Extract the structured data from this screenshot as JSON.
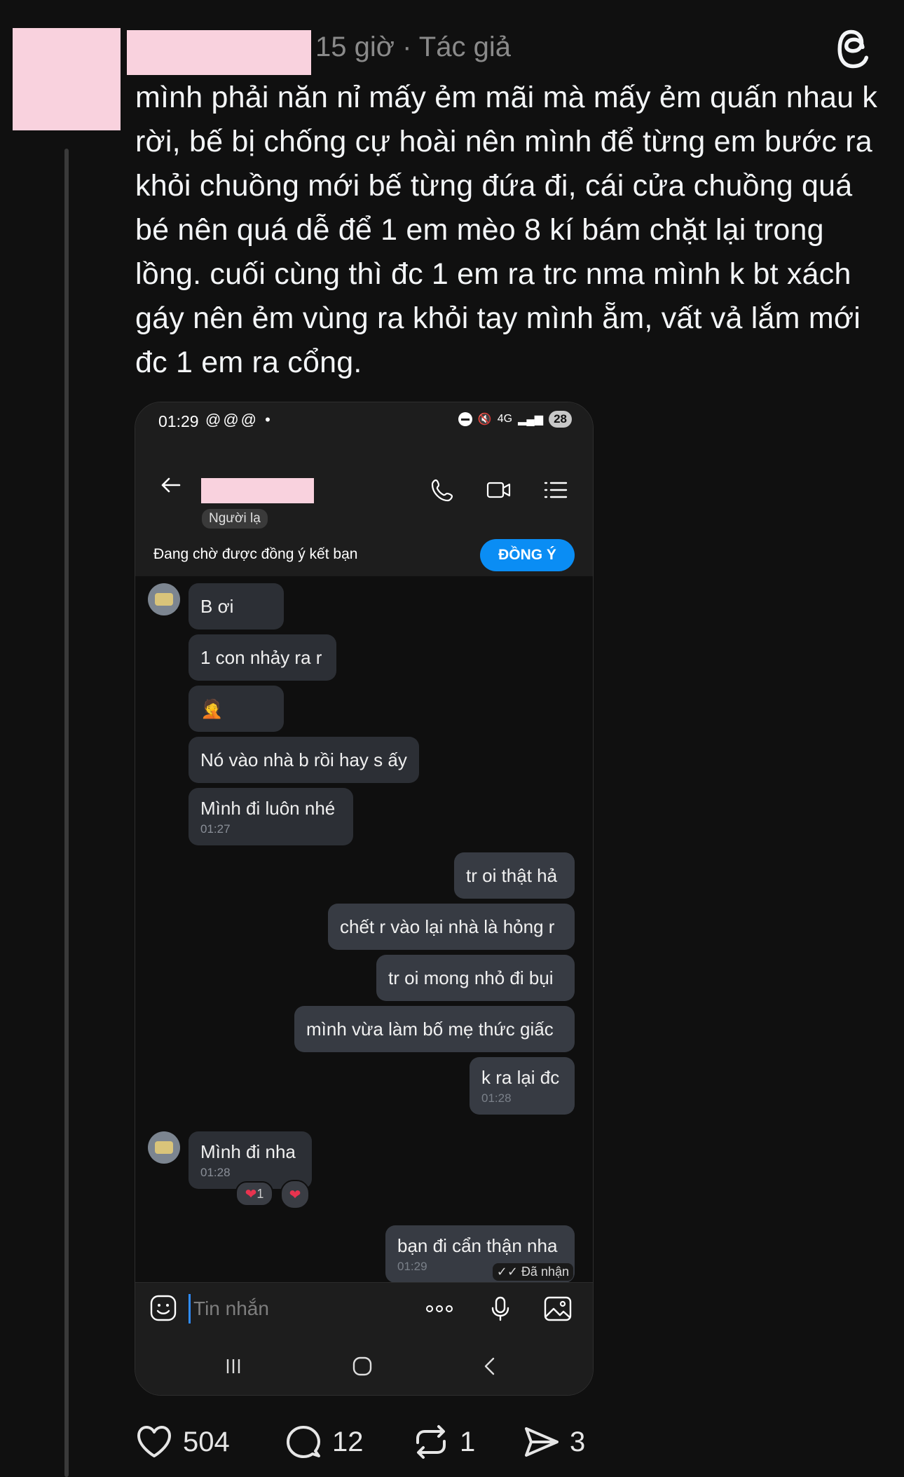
{
  "post": {
    "meta": "15 giờ · Tác giả",
    "text": "mình phải năn nỉ mấy ẻm mãi mà mấy ẻm quấn nhau k rời, bế bị chống cự hoài nên mình để từng em bước ra khỏi chuồng mới bế từng đứa đi, cái cửa chuồng quá bé nên quá dễ để 1 em mèo 8 kí bám chặt lại trong lồng. cuối cùng thì đc 1 em ra trc nma mình k bt xách gáy nên ẻm vùng ra khỏi tay mình ẵm, vất vả lắm mới đc 1 em ra cổng."
  },
  "phone": {
    "status": {
      "time": "01:29",
      "battery": "28",
      "network": "4G"
    },
    "header": {
      "stranger_label": "Người lạ"
    },
    "pending": {
      "text": "Đang chờ được đồng ý kết bạn",
      "accept_label": "ĐỒNG Ý"
    },
    "messages": [
      {
        "side": "in",
        "text": "B ơi",
        "time": ""
      },
      {
        "side": "in",
        "text": "1 con nhảy ra r",
        "time": ""
      },
      {
        "side": "in",
        "text": "🤦",
        "time": ""
      },
      {
        "side": "in",
        "text": "Nó vào nhà b rồi hay s ấy",
        "time": ""
      },
      {
        "side": "in",
        "text": "Mình đi luôn nhé",
        "time": "01:27"
      },
      {
        "side": "out",
        "text": "tr oi thật hả",
        "time": ""
      },
      {
        "side": "out",
        "text": "chết r vào lại nhà là hỏng r",
        "time": ""
      },
      {
        "side": "out",
        "text": "tr oi mong nhỏ đi bụi",
        "time": ""
      },
      {
        "side": "out",
        "text": "mình vừa làm bố mẹ thức giấc",
        "time": ""
      },
      {
        "side": "out",
        "text": "k ra lại đc",
        "time": "01:28"
      },
      {
        "side": "in",
        "text": "Mình đi nha",
        "time": "01:28"
      },
      {
        "side": "out",
        "text": "bạn đi cẩn thận nha",
        "time": "01:29"
      }
    ],
    "reaction_count": "1",
    "delivered": "Đã nhận",
    "composer": {
      "placeholder": "Tin nhắn"
    }
  },
  "actions": {
    "likes": "504",
    "comments": "12",
    "reposts": "1",
    "shares": "3"
  },
  "colors": {
    "accent": "#0a8df4",
    "heart": "#e8334f",
    "background": "#101010"
  }
}
